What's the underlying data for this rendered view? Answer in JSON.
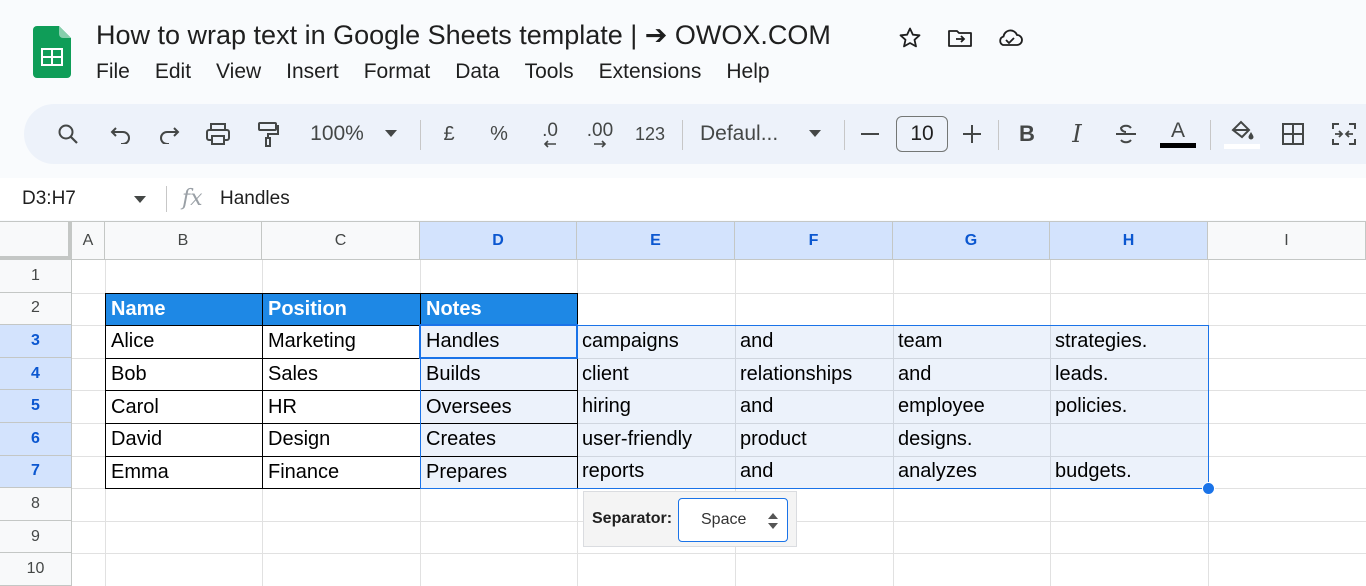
{
  "document": {
    "title": "How to wrap text in Google Sheets template | ➔ OWOX.COM"
  },
  "menu": [
    "File",
    "Edit",
    "View",
    "Insert",
    "Format",
    "Data",
    "Tools",
    "Extensions",
    "Help"
  ],
  "toolbar": {
    "zoom": "100%",
    "currency": "£",
    "percent": "%",
    "decimal_decrease": ".0",
    "decimal_increase": ".00",
    "number_format": "123",
    "font": "Defaul...",
    "font_size": "10",
    "bold": "B",
    "italic": "I",
    "text_color": "A"
  },
  "formula_bar": {
    "name_box": "D3:H7",
    "fx": "fx",
    "content": "Handles"
  },
  "columns": [
    "A",
    "B",
    "C",
    "D",
    "E",
    "F",
    "G",
    "H",
    "I"
  ],
  "rows": [
    "1",
    "2",
    "3",
    "4",
    "5",
    "6",
    "7",
    "8",
    "9",
    "10"
  ],
  "table": {
    "headers": [
      "Name",
      "Position",
      "Notes"
    ],
    "rows": [
      [
        "Alice",
        "Marketing",
        "Handles",
        "campaigns",
        "and",
        "team",
        "strategies."
      ],
      [
        "Bob",
        "Sales",
        "Builds",
        "client",
        "relationships",
        "and",
        "leads."
      ],
      [
        "Carol",
        "HR",
        "Oversees",
        "hiring",
        "and",
        "employee",
        "policies."
      ],
      [
        "David",
        "Design",
        "Creates",
        "user-friendly",
        "product",
        "designs.",
        ""
      ],
      [
        "Emma",
        "Finance",
        "Prepares",
        "reports",
        "and",
        "analyzes",
        "budgets."
      ]
    ]
  },
  "separator_popup": {
    "label": "Separator:",
    "value": "Space"
  },
  "colors": {
    "header_fill": "#1e88e5",
    "selection": "#1a73e8",
    "sheets_green": "#0f9d58"
  }
}
